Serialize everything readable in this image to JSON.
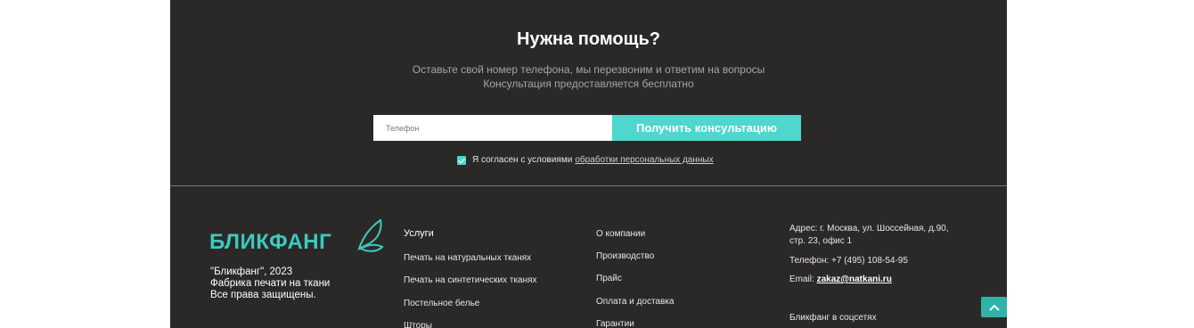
{
  "help": {
    "title": "Нужна помощь?",
    "line1": "Оставьте свой номер телефона, мы перезвоним и ответим на вопросы",
    "line2": "Консультация предоставляется бесплатно",
    "phone_placeholder": "Телефон",
    "button_label": "Получить консультацию",
    "agree_text": "Я согласен с условиями",
    "agree_link": "обработки персональных данных"
  },
  "footer": {
    "logo_text": "БЛИКФАНГ",
    "copy_line1": "\"Бликфанг\", 2023",
    "copy_line2": "Фабрика печати на ткани",
    "copy_line3": "Все права защищены.",
    "services": {
      "title": "Услуги",
      "items": [
        "Печать на натуральных тканях",
        "Печать на синтетических тканях",
        "Постельное белье",
        "Шторы"
      ]
    },
    "company": {
      "items": [
        "О компании",
        "Производство",
        "Прайс",
        "Оплата и доставка",
        "Гарантии"
      ]
    },
    "contacts": {
      "address_line1": "Адрес: г. Москва, ул. Шоссейная, д.90,",
      "address_line2": "стр. 23, офис 1",
      "phone": "Телефон: +7 (495) 108-54-95",
      "email_label": "Email:",
      "email": "zakaz@natkani.ru",
      "social": "Бликфанг в соцсетях"
    }
  },
  "colors": {
    "background": "#2b2927",
    "accent": "#4fd6cf",
    "scroll_button": "#2fb3a9"
  }
}
